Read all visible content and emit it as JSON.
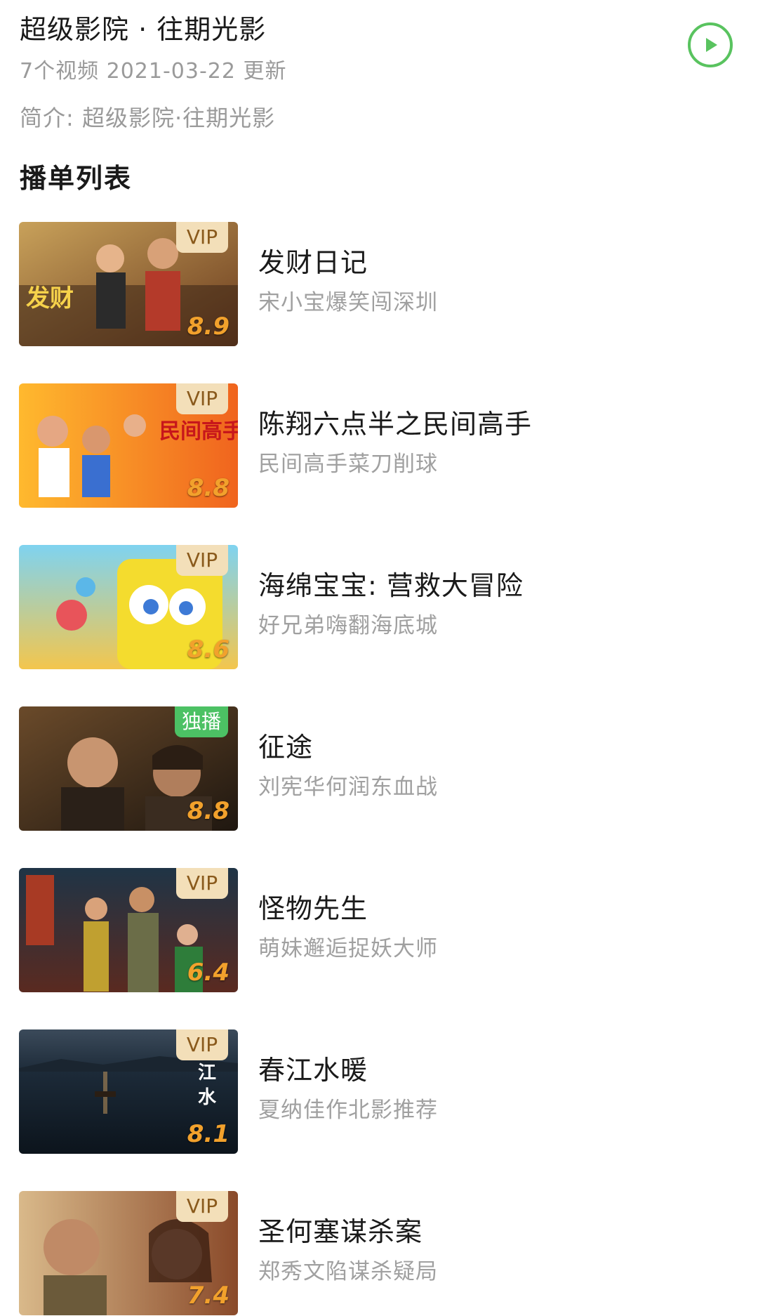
{
  "header": {
    "title": "超级影院 · 往期光影",
    "meta": "7个视频  2021-03-22 更新",
    "play_icon": "play-circle-icon",
    "accent": "#59c35f"
  },
  "intro": "简介:  超级影院·往期光影",
  "section_title": "播单列表",
  "items": [
    {
      "title": "发财日记",
      "subtitle": "宋小宝爆笑闯深圳",
      "badge": "VIP",
      "score": "8.9"
    },
    {
      "title": "陈翔六点半之民间高手",
      "subtitle": "民间高手菜刀削球",
      "badge": "VIP",
      "score": "8.8"
    },
    {
      "title": "海绵宝宝:  营救大冒险",
      "subtitle": "好兄弟嗨翻海底城",
      "badge": "VIP",
      "score": "8.6"
    },
    {
      "title": "征途",
      "subtitle": "刘宪华何润东血战",
      "badge": "独播",
      "score": "8.8"
    },
    {
      "title": "怪物先生",
      "subtitle": "萌妹邂逅捉妖大师",
      "badge": "VIP",
      "score": "6.4"
    },
    {
      "title": "春江水暖",
      "subtitle": "夏纳佳作北影推荐",
      "badge": "VIP",
      "score": "8.1"
    },
    {
      "title": "圣何塞谋杀案",
      "subtitle": "郑秀文陷谋杀疑局",
      "badge": "VIP",
      "score": "7.4"
    }
  ]
}
